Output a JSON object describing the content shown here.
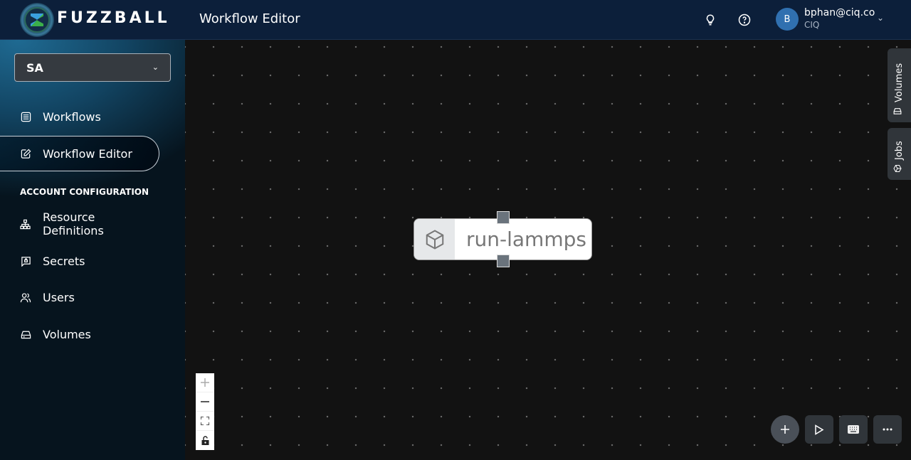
{
  "header": {
    "brand": "FUZZBALL",
    "page_title": "Workflow Editor",
    "icons": [
      "lightbulb-icon",
      "help-icon"
    ],
    "user": {
      "avatar_initial": "B",
      "email": "bphan@ciq.co",
      "org": "CIQ"
    }
  },
  "sidebar": {
    "account_select": {
      "value": "SA"
    },
    "items": [
      {
        "label": "Workflows",
        "icon": "list-icon",
        "active": false
      },
      {
        "label": "Workflow Editor",
        "icon": "edit-icon",
        "active": true
      }
    ],
    "section_label": "ACCOUNT CONFIGURATION",
    "config_items": [
      {
        "label": "Resource Definitions",
        "icon": "hierarchy-icon"
      },
      {
        "label": "Secrets",
        "icon": "secret-icon"
      },
      {
        "label": "Users",
        "icon": "users-icon"
      },
      {
        "label": "Volumes",
        "icon": "drive-icon"
      }
    ]
  },
  "canvas": {
    "node": {
      "label": "run-lammps",
      "icon": "cube-icon"
    },
    "zoom_controls": [
      "zoom-in",
      "zoom-out",
      "fit-view",
      "lock"
    ],
    "side_tabs": [
      {
        "label": "Volumes"
      },
      {
        "label": "Jobs"
      }
    ],
    "actions": [
      "add",
      "run",
      "keyboard",
      "more"
    ]
  }
}
